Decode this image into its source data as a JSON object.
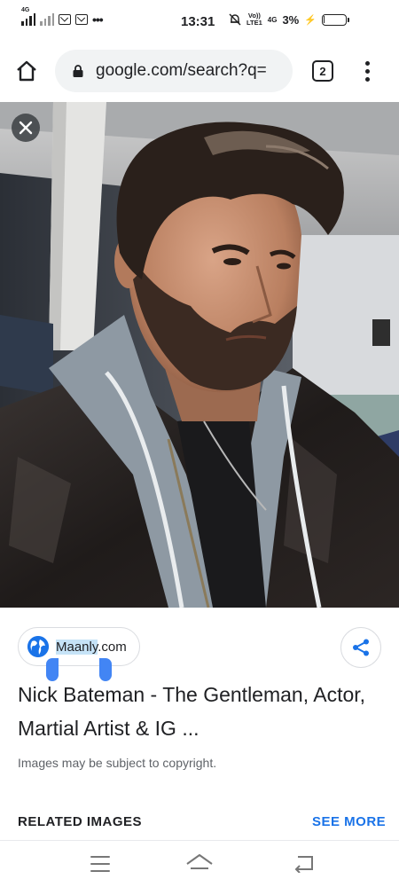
{
  "status_bar": {
    "network_label": "4G",
    "time": "13:31",
    "volte_line1": "Vo))",
    "volte_line2": "LTE1",
    "network_type": "4G",
    "battery_percent": "3%",
    "battery_level": 0.03,
    "more_notifications": "•••"
  },
  "browser": {
    "url": "google.com/search?q=",
    "tab_count": "2",
    "icons": [
      "home-icon",
      "lock-icon",
      "tab-switcher-icon",
      "overflow-menu-icon"
    ]
  },
  "viewer": {
    "close_icon": "close-icon"
  },
  "result": {
    "source_highlight": "Maanly",
    "source_rest": ".com",
    "title": "Nick Bateman - The Gentleman, Actor, Martial Artist & IG ...",
    "copyright_notice": "Images may be subject to copyright.",
    "share_icon": "share-icon"
  },
  "related": {
    "heading": "RELATED IMAGES",
    "see_more": "SEE MORE"
  },
  "colors": {
    "accent": "#1a73e8",
    "selection_handle": "#4285f4",
    "selection_highlight": "#c6e3f7",
    "bolt": "#f2c200"
  }
}
